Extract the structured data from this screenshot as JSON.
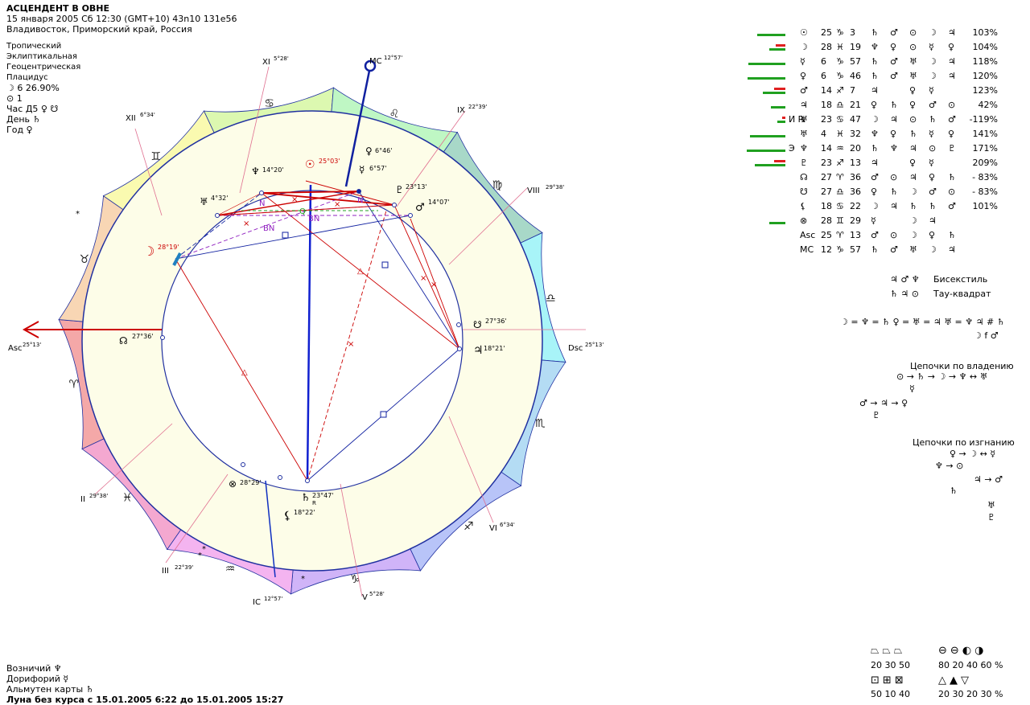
{
  "header": {
    "title": "АСЦЕНДЕНТ В ОВНЕ",
    "line2": "15 января 2005  Сб  12:30 (GMT+10) 43n10  131e56",
    "line3": "Владивосток, Приморский край, Россия"
  },
  "settings": [
    "Тропический",
    "Эклиптикальная",
    "Геоцентрическая",
    "Плацидус"
  ],
  "moon_phase": "☽  6 26.90%",
  "sun_line": "⊙  1",
  "hour_line": "Час Д5 ♀ ☋",
  "day_line": "День ♄",
  "year_line": "Год ♀",
  "cusps": {
    "asc": {
      "label": "Asc",
      "deg": "25°13'"
    },
    "dsc": {
      "label": "Dsc",
      "deg": "25°13'"
    },
    "mc": {
      "label": "MC",
      "deg": "12°57'"
    },
    "ic": {
      "label": "IC",
      "deg": "12°57'"
    },
    "h2": {
      "label": "II",
      "deg": "29°38'"
    },
    "h3": {
      "label": "III",
      "deg": "22°39'"
    },
    "h5": {
      "label": "V",
      "deg": "5°28'"
    },
    "h6": {
      "label": "VI",
      "deg": "6°34'"
    },
    "h8": {
      "label": "VIII",
      "deg": "29°38'"
    },
    "h9": {
      "label": "IX",
      "deg": "22°39'"
    },
    "h11": {
      "label": "XI",
      "deg": "5°28'"
    },
    "h12": {
      "label": "XII",
      "deg": "6°34'"
    }
  },
  "zodiac_glyphs": [
    "♈",
    "♉",
    "♊",
    "♋",
    "♌",
    "♍",
    "♎",
    "♏",
    "♐",
    "♑",
    "♒",
    "♓"
  ],
  "zodiac_colors": [
    "#f4a8a8",
    "#f8d6b4",
    "#fafab0",
    "#dcf8b0",
    "#bff7c4",
    "#a8d8c8",
    "#a8f4f8",
    "#b4dcf4",
    "#b8c4f8",
    "#d0b4f8",
    "#f4b4f0",
    "#f4a8d0"
  ],
  "planets_chart": [
    {
      "glyph": "☉",
      "deg": "25°03'",
      "color": "#cc0000"
    },
    {
      "glyph": "♀",
      "deg": "6°46'",
      "color": "#000"
    },
    {
      "glyph": "☿",
      "deg": "6°57'",
      "color": "#000"
    },
    {
      "glyph": "♆",
      "deg": "14°20'",
      "color": "#000"
    },
    {
      "glyph": "♅",
      "deg": "4°32'",
      "color": "#000"
    },
    {
      "glyph": "♇",
      "deg": "23°13'",
      "color": "#000"
    },
    {
      "glyph": "♂",
      "deg": "14°07'",
      "color": "#000"
    },
    {
      "glyph": "☽",
      "deg": "28°19'",
      "color": "#cc0000"
    },
    {
      "glyph": "☊",
      "deg": "27°36'",
      "color": "#000"
    },
    {
      "glyph": "☋",
      "deg": "27°36'",
      "color": "#000"
    },
    {
      "glyph": "♃",
      "deg": "18°21'",
      "color": "#000"
    },
    {
      "glyph": "⊗",
      "deg": "28°29'",
      "color": "#000"
    },
    {
      "glyph": "♄",
      "deg": "23°47'",
      "color": "#000"
    },
    {
      "glyph": "⚸",
      "deg": "18°22'",
      "color": "#000"
    }
  ],
  "retro_mark": "R",
  "aspect_labels": {
    "n": "N",
    "bn": "BN",
    "q": "Q"
  },
  "table": [
    {
      "p": "☉",
      "r": "",
      "d": "25",
      "s": "♑",
      "m": " 3",
      "a": [
        "♄",
        "♂",
        "⊙",
        "☽",
        "♃"
      ],
      "pct": "103%",
      "g": 35,
      "rd": 0
    },
    {
      "p": "☽",
      "r": "",
      "d": "28",
      "s": "♓",
      "m": "19",
      "a": [
        "♆",
        "♀",
        "⊙",
        "☿",
        "♀"
      ],
      "pct": "104%",
      "g": 20,
      "rd": 12
    },
    {
      "p": "☿",
      "r": "",
      "d": " 6",
      "s": "♑",
      "m": "57",
      "a": [
        "♄",
        "♂",
        "♅",
        "☽",
        "♃"
      ],
      "pct": "118%",
      "g": 46,
      "rd": 0
    },
    {
      "p": "♀",
      "r": "",
      "d": " 6",
      "s": "♑",
      "m": "46",
      "a": [
        "♄",
        "♂",
        "♅",
        "☽",
        "♃"
      ],
      "pct": "120%",
      "g": 47,
      "rd": 0
    },
    {
      "p": "♂",
      "r": "",
      "d": "14",
      "s": "♐",
      "m": " 7",
      "a": [
        "♃",
        "",
        "♀",
        "☿",
        ""
      ],
      "pct": "123%",
      "g": 28,
      "rd": 14
    },
    {
      "p": "♃",
      "r": "",
      "d": "18",
      "s": "♎",
      "m": "21",
      "a": [
        "♀",
        "♄",
        "♀",
        "♂",
        "⊙"
      ],
      "pct": "42%",
      "g": 18,
      "rd": 0
    },
    {
      "p": "♅",
      "r": "И ℞",
      "d": "23",
      "s": "♋",
      "m": "47",
      "a": [
        "☽",
        "♃",
        "⊙",
        "♄",
        "♂"
      ],
      "pct": "-119%",
      "g": 10,
      "rd": 4
    },
    {
      "p": "♅",
      "r": "",
      "d": " 4",
      "s": "♓",
      "m": "32",
      "a": [
        "♆",
        "♀",
        "♄",
        "☿",
        "♀"
      ],
      "pct": "141%",
      "g": 44,
      "rd": 0
    },
    {
      "p": "♆",
      "r": "Э",
      "d": "14",
      "s": "♒",
      "m": "20",
      "a": [
        "♄",
        "♆",
        "♃",
        "⊙",
        "♇"
      ],
      "pct": "171%",
      "g": 48,
      "rd": 0
    },
    {
      "p": "♇",
      "r": "",
      "d": "23",
      "s": "♐",
      "m": "13",
      "a": [
        "♃",
        "",
        "♀",
        "☿",
        ""
      ],
      "pct": "209%",
      "g": 38,
      "rd": 14
    },
    {
      "p": "☊",
      "r": "",
      "d": "27",
      "s": "♈",
      "m": "36",
      "a": [
        "♂",
        "⊙",
        "♃",
        "♀",
        "♄"
      ],
      "pct": "- 83%",
      "g": 0,
      "rd": 0
    },
    {
      "p": "☋",
      "r": "",
      "d": "27",
      "s": "♎",
      "m": "36",
      "a": [
        "♀",
        "♄",
        "☽",
        "♂",
        "⊙"
      ],
      "pct": "- 83%",
      "g": 0,
      "rd": 0
    },
    {
      "p": "⚸",
      "r": "",
      "d": "18",
      "s": "♋",
      "m": "22",
      "a": [
        "☽",
        "♃",
        "♄",
        "♄",
        "♂"
      ],
      "pct": "101%",
      "g": 0,
      "rd": 0
    },
    {
      "p": "⊗",
      "r": "",
      "d": "28",
      "s": "♊",
      "m": "29",
      "a": [
        "☿",
        "",
        "☽",
        "♃",
        ""
      ],
      "pct": "",
      "g": 20,
      "rd": 0
    },
    {
      "p": "Asc",
      "r": "",
      "d": "25",
      "s": "♈",
      "m": "13",
      "a": [
        "♂",
        "⊙",
        "☽",
        "♀",
        "♄"
      ],
      "pct": "",
      "g": 0,
      "rd": 0
    },
    {
      "p": "MC",
      "r": "",
      "d": "12",
      "s": "♑",
      "m": "57",
      "a": [
        "♄",
        "♂",
        "♅",
        "☽",
        "♃"
      ],
      "pct": "",
      "g": 0,
      "rd": 0
    }
  ],
  "configs": [
    {
      "glyphs": "♃ ♂ ♆",
      "name": "Бисекстиль"
    },
    {
      "glyphs": "♄ ♃ ⊙",
      "name": "Тау-квадрат"
    }
  ],
  "equalities": {
    "line1": "☽ = ♆ = ♄  ♀ = ♅ = ♃  ♅ = ♆ ♃ # ♄",
    "line2": "☽ f ♂"
  },
  "chain_owner": {
    "title": "Цепочки по владению",
    "lines": [
      "⊙ → ♄ → ☽ → ♆ ↔ ♅",
      "☿",
      "♂ → ♃ → ♀",
      "♇"
    ]
  },
  "chain_exile": {
    "title": "Цепочки по изгнанию",
    "lines": [
      "♀ → ☽ ↔ ☿",
      "♆ → ⊙",
      "♃ → ♂",
      "♄",
      "♅",
      "♇"
    ]
  },
  "footer": {
    "vozn": "Возничий ♆",
    "dorif": "Дорифорий ☿",
    "almut": "Альмутен карты ♄",
    "moon": "Луна без курса с 15.01.2005  6:22 до 15.01.2005 15:27"
  },
  "legend": {
    "row1_icons": [
      "⏢",
      "⏢",
      "⏢",
      "⊖",
      "⊖",
      "◐",
      "◑"
    ],
    "row1_vals": "20 30 50",
    "row1_vals2": "80 20 40 60 %",
    "row2_icons": [
      "⊡",
      "⊞",
      "⊠",
      "△",
      "▲",
      "▽"
    ],
    "row2_vals": "50 10 40",
    "row2_vals2": "20 30 20 30 %"
  },
  "stars": [
    "*",
    "*",
    "*",
    "*"
  ]
}
